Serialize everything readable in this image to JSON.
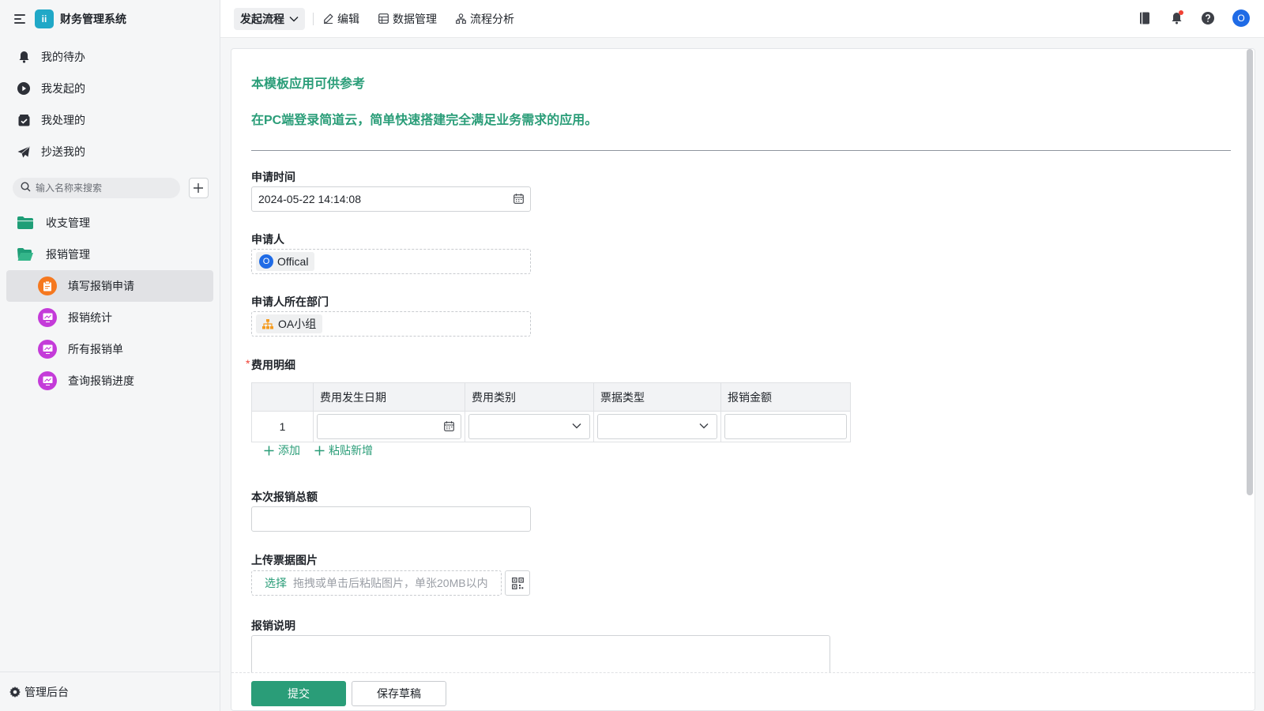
{
  "app": {
    "title": "财务管理系统",
    "logo_text": "ii",
    "brand_color": "#2a9d78"
  },
  "sidebar": {
    "nav": [
      {
        "label": "我的待办",
        "icon": "bell-icon"
      },
      {
        "label": "我发起的",
        "icon": "play-circle-icon"
      },
      {
        "label": "我处理的",
        "icon": "check-box-icon"
      },
      {
        "label": "抄送我的",
        "icon": "paper-plane-icon"
      }
    ],
    "search_placeholder": "输入名称来搜索",
    "folders": [
      {
        "label": "收支管理",
        "icon": "folder-icon"
      },
      {
        "label": "报销管理",
        "icon": "folder-open-icon"
      }
    ],
    "forms": [
      {
        "label": "填写报销申请",
        "icon": "form-icon",
        "color": "#f5781f",
        "active": true
      },
      {
        "label": "报销统计",
        "icon": "report-icon",
        "color": "#c43bd9"
      },
      {
        "label": "所有报销单",
        "icon": "report-icon",
        "color": "#c43bd9"
      },
      {
        "label": "查询报销进度",
        "icon": "report-icon",
        "color": "#c43bd9"
      }
    ],
    "admin_label": "管理后台"
  },
  "topbar": {
    "flow_button": "发起流程",
    "links": [
      {
        "label": "编辑",
        "icon": "pencil-icon"
      },
      {
        "label": "数据管理",
        "icon": "table-icon"
      },
      {
        "label": "流程分析",
        "icon": "flow-icon"
      }
    ],
    "user_initial": "O"
  },
  "form": {
    "desc1": "本模板应用可供参考",
    "desc2": "在PC端登录简道云，简单快速搭建完全满足业务需求的应用。",
    "apply_time_label": "申请时间",
    "apply_time_value": "2024-05-22 14:14:08",
    "applicant_label": "申请人",
    "applicant_initial": "O",
    "applicant_name": "Offical",
    "dept_label": "申请人所在部门",
    "dept_name": "OA小组",
    "expense_label": "费用明细",
    "required_mark": "*",
    "table_headers": [
      "",
      "费用发生日期",
      "费用类别",
      "票据类型",
      "报销金额"
    ],
    "table_rows": [
      {
        "index": "1"
      }
    ],
    "add_label": "添加",
    "paste_label": "粘贴新增",
    "total_label": "本次报销总额",
    "upload_label": "上传票据图片",
    "upload_pick": "选择",
    "upload_hint": "拖拽或单击后粘贴图片，单张20MB以内",
    "remark_label": "报销说明"
  },
  "footer": {
    "submit_label": "提交",
    "draft_label": "保存草稿"
  }
}
